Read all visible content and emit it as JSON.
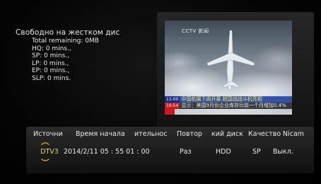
{
  "storage": {
    "title": "Свободно на жестком дис",
    "lines": [
      "Total remaining: 0MB",
      "HQ: 0 mins.,",
      "SP: 0 mins.,",
      "LP: 0 mins.,",
      "EP: 0 mins.,",
      "SLP: 0 mins."
    ]
  },
  "preview": {
    "channel_logo": "CCTV 新闻",
    "ticker_top_time": "11:00",
    "ticker_top": "中国航展下周开幕 超国战战斗机亮相",
    "ticker_bottom_time": "16:54",
    "ticker_bottom": "显示：美国9月份企业库存比前一个月增加0.4%"
  },
  "schedule": {
    "headers": [
      "Источник",
      "Время начала",
      "ительнос",
      "Повтор",
      "кий диск",
      "Качество",
      "Nicam"
    ],
    "row": {
      "source": "DTV3",
      "start": "2014/2/11   05 : 55   01 : 00",
      "repeat": "Раз",
      "disk": "HDD",
      "quality": "SP",
      "nicam": "Выкл."
    }
  },
  "colors": {
    "accent_chevron": "#d9b800",
    "ticker_blue": "#0b2f8a",
    "ticker_red": "#c41a1a"
  }
}
